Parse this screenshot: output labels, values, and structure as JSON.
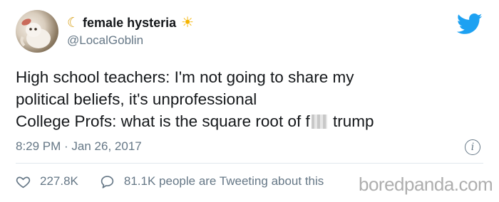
{
  "author": {
    "display_name": "female hysteria",
    "name_prefix_icon": "crescent-moon-emoji",
    "name_suffix_icon": "sun-emoji",
    "handle": "@LocalGoblin"
  },
  "tweet": {
    "line1": "High school teachers: I'm not going to share my",
    "line2": "political beliefs, it's unprofessional",
    "line3_before": "College Profs: what is the square root of f",
    "line3_censored": "uck",
    "line3_after": " trump",
    "timestamp": "8:29 PM · Jan 26, 2017"
  },
  "engagement": {
    "likes": "227.8K",
    "retweets_text": "81.1K people are Tweeting about this"
  },
  "watermark": "boredpanda.com",
  "colors": {
    "text": "#14171a",
    "muted": "#657786",
    "twitter_blue": "#1da1f2",
    "divider": "#e1e8ed"
  }
}
